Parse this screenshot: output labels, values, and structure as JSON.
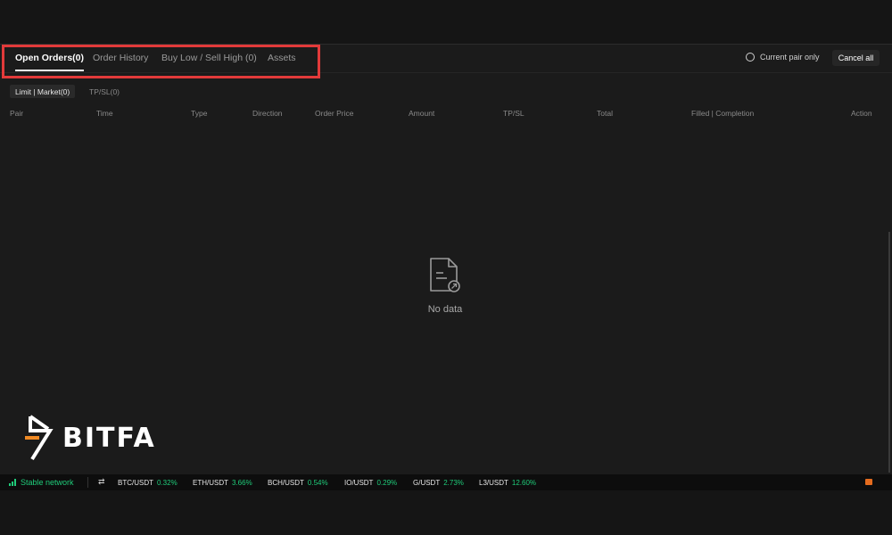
{
  "tabs": [
    {
      "label": "Open Orders(0)",
      "active": true
    },
    {
      "label": "Order History",
      "active": false
    },
    {
      "label": "Buy Low / Sell High (0)",
      "active": false
    },
    {
      "label": "Assets",
      "active": false
    }
  ],
  "filters": {
    "current_pair_only": "Current pair only",
    "cancel_all": "Cancel all"
  },
  "subtabs": [
    {
      "label": "Limit | Market(0)",
      "active": true
    },
    {
      "label": "TP/SL(0)",
      "active": false
    }
  ],
  "columns": [
    "Pair",
    "Time",
    "Type",
    "Direction",
    "Order Price",
    "Amount",
    "TP/SL",
    "Total",
    "Filled | Completion",
    "Action"
  ],
  "empty_state": {
    "label": "No data",
    "icon": "document-icon"
  },
  "logo": {
    "text": "BITFA"
  },
  "status_bar": {
    "network": "Stable network",
    "tickers": [
      {
        "pair": "BTC/USDT",
        "change": "0.32%"
      },
      {
        "pair": "ETH/USDT",
        "change": "3.66%"
      },
      {
        "pair": "BCH/USDT",
        "change": "0.54%"
      },
      {
        "pair": "IO/USDT",
        "change": "0.29%"
      },
      {
        "pair": "G/USDT",
        "change": "2.73%"
      },
      {
        "pair": "L3/USDT",
        "change": "12.60%"
      }
    ]
  },
  "colors": {
    "accent_up": "#1fcc7a",
    "highlight": "#e23a3a",
    "background": "#1b1b1b"
  }
}
